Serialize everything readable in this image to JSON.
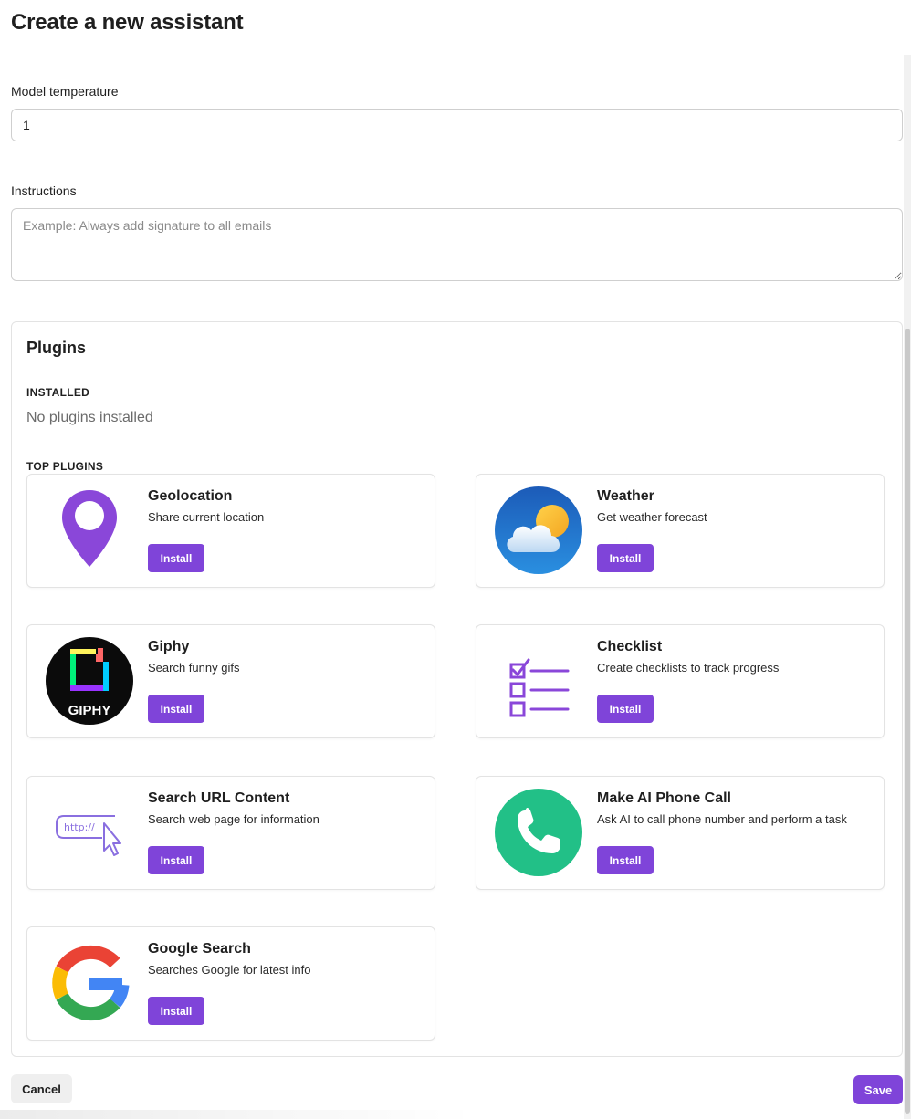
{
  "page": {
    "title": "Create a new assistant"
  },
  "form": {
    "temperature_label": "Model temperature",
    "temperature_value": "1",
    "instructions_label": "Instructions",
    "instructions_placeholder": "Example: Always add signature to all emails"
  },
  "plugins": {
    "title": "Plugins",
    "installed_heading": "INSTALLED",
    "installed_empty": "No plugins installed",
    "top_heading": "TOP PLUGINS",
    "install_label": "Install",
    "items": [
      {
        "name": "Geolocation",
        "description": "Share current location",
        "icon": "location-pin-icon"
      },
      {
        "name": "Weather",
        "description": "Get weather forecast",
        "icon": "weather-icon"
      },
      {
        "name": "Giphy",
        "description": "Search funny gifs",
        "icon": "giphy-logo-icon",
        "logo_text": "GIPHY"
      },
      {
        "name": "Checklist",
        "description": "Create checklists to track progress",
        "icon": "checklist-icon"
      },
      {
        "name": "Search URL Content",
        "description": "Search web page for information",
        "icon": "url-cursor-icon",
        "icon_text": "http://"
      },
      {
        "name": "Make AI Phone Call",
        "description": "Ask AI to call phone number and perform a task",
        "icon": "phone-icon"
      },
      {
        "name": "Google Search",
        "description": "Searches Google for latest info",
        "icon": "google-logo-icon"
      }
    ]
  },
  "actions": {
    "cancel_label": "Cancel",
    "save_label": "Save"
  },
  "colors": {
    "accent": "#7f44d9",
    "phone_green": "#22c087"
  }
}
